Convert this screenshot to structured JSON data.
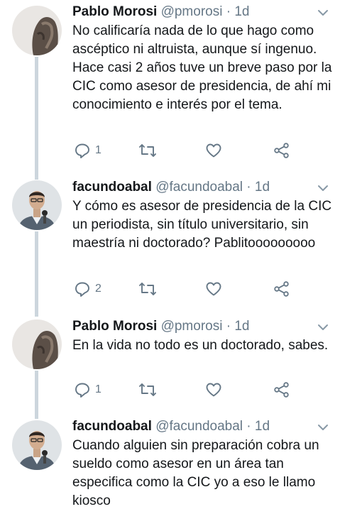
{
  "colors": {
    "text": "#14171a",
    "secondary": "#657786",
    "icon": "#657786",
    "thread": "#ccd6dd"
  },
  "tweets": [
    {
      "name": "Pablo Morosi",
      "handle": "@pmorosi",
      "sep": "·",
      "time": "1d",
      "avatar": "pablo-avatar",
      "text": "No calificaría nada de lo que hago como ascéptico ni altruista, aunque sí ingenuo. Hace casi 2 años tuve un breve paso por la CIC como asesor de presidencia, de ahí mi conocimiento e interés por el tema.",
      "replies": "1"
    },
    {
      "name": "facundoabal",
      "handle": "@facundoabal",
      "sep": "·",
      "time": "1d",
      "avatar": "facundo-avatar",
      "text": "Y cómo es asesor de presidencia de la CIC un periodista, sin título universitario, sin maestría ni doctorado? Pablitooooooooo",
      "replies": "2"
    },
    {
      "name": "Pablo Morosi",
      "handle": "@pmorosi",
      "sep": "·",
      "time": "1d",
      "avatar": "pablo-avatar",
      "text": "En la vida no todo es un doctorado, sabes.",
      "replies": "1"
    },
    {
      "name": "facundoabal",
      "handle": "@facundoabal",
      "sep": "·",
      "time": "1d",
      "avatar": "facundo-avatar",
      "text": "Cuando alguien sin preparación cobra un sueldo como asesor en un área tan especifica como la CIC yo a eso le llamo kiosco",
      "replies": ""
    }
  ]
}
